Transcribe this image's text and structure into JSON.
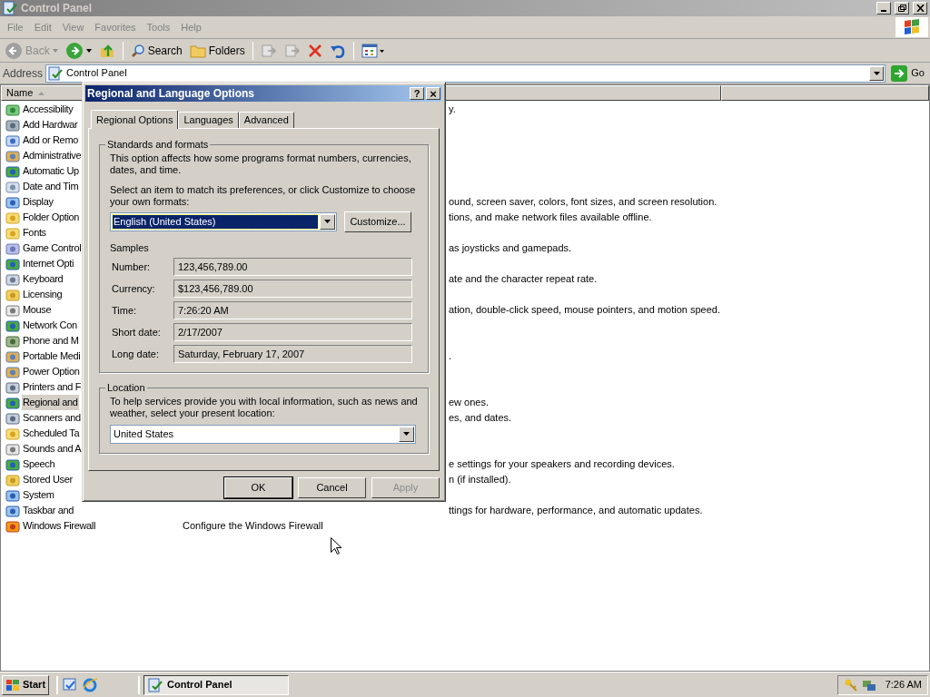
{
  "window": {
    "title": "Control Panel"
  },
  "menu": [
    "File",
    "Edit",
    "View",
    "Favorites",
    "Tools",
    "Help"
  ],
  "toolbar": [
    {
      "kind": "back",
      "label": "Back",
      "disabled": true
    },
    {
      "kind": "forward",
      "disabled": false
    },
    {
      "kind": "up",
      "disabled": false
    },
    {
      "kind": "sep"
    },
    {
      "kind": "search",
      "label": "Search",
      "disabled": false
    },
    {
      "kind": "folders",
      "label": "Folders",
      "disabled": false
    },
    {
      "kind": "sep"
    },
    {
      "kind": "moveto",
      "disabled": true
    },
    {
      "kind": "copyto",
      "disabled": true
    },
    {
      "kind": "delete",
      "disabled": false
    },
    {
      "kind": "undo",
      "disabled": false
    },
    {
      "kind": "sep"
    },
    {
      "kind": "views",
      "disabled": false
    }
  ],
  "address": {
    "label": "Address",
    "value": "Control Panel",
    "go": "Go"
  },
  "list": {
    "columns": [
      "Name"
    ],
    "rows": [
      {
        "name": "Accessibility",
        "comment": "y.",
        "selected": false
      },
      {
        "name": "Add Hardwar",
        "selected": false
      },
      {
        "name": "Add or Remo",
        "selected": false
      },
      {
        "name": "Administrative",
        "selected": false
      },
      {
        "name": "Automatic Up",
        "selected": false
      },
      {
        "name": "Date and Tim",
        "selected": false
      },
      {
        "name": "Display",
        "comment": "ound, screen saver, colors, font sizes, and screen resolution.",
        "selected": false
      },
      {
        "name": "Folder Option",
        "comment": "tions, and make network files available offline.",
        "selected": false
      },
      {
        "name": "Fonts",
        "selected": false
      },
      {
        "name": "Game Control",
        "comment": "as joysticks and gamepads.",
        "selected": false
      },
      {
        "name": "Internet Opti",
        "selected": false
      },
      {
        "name": "Keyboard",
        "comment": "ate and the character repeat rate.",
        "selected": false
      },
      {
        "name": "Licensing",
        "selected": false
      },
      {
        "name": "Mouse",
        "comment": "ation, double-click speed, mouse pointers, and motion speed.",
        "selected": false
      },
      {
        "name": "Network Con",
        "selected": false
      },
      {
        "name": "Phone and M",
        "selected": false
      },
      {
        "name": "Portable Medi",
        "comment": ".",
        "selected": false
      },
      {
        "name": "Power Option",
        "selected": false
      },
      {
        "name": "Printers and F",
        "selected": false
      },
      {
        "name": "Regional and",
        "comment": "ew ones.",
        "selected": true
      },
      {
        "name": "Scanners and",
        "comment": "es, and dates.",
        "selected": false
      },
      {
        "name": "Scheduled Ta",
        "selected": false
      },
      {
        "name": "Sounds and A",
        "selected": false
      },
      {
        "name": "Speech",
        "comment": "e settings for your speakers and recording devices.",
        "selected": false
      },
      {
        "name": "Stored User",
        "comment": "n (if installed).",
        "selected": false
      },
      {
        "name": "System",
        "selected": false
      },
      {
        "name": "Taskbar and",
        "comment": "ttings for hardware, performance, and automatic updates.",
        "selected": false
      },
      {
        "name": "Windows Firewall",
        "comment": "Configure the Windows Firewall",
        "selected": false
      }
    ]
  },
  "dialog": {
    "title": "Regional and Language Options",
    "help": "?",
    "close": "×",
    "tabs": [
      {
        "label": "Regional Options",
        "selected": true
      },
      {
        "label": "Languages",
        "selected": false
      },
      {
        "label": "Advanced",
        "selected": false
      }
    ],
    "standards": {
      "legend": "Standards and formats",
      "intro": "This option affects how some programs format numbers, currencies, dates, and time.",
      "prompt": "Select an item to match its preferences, or click Customize to choose your own formats:",
      "format": "English (United States)",
      "customize": "Customize...",
      "samples_label": "Samples",
      "samples": [
        {
          "label": "Number:",
          "value": "123,456,789.00"
        },
        {
          "label": "Currency:",
          "value": "$123,456,789.00"
        },
        {
          "label": "Time:",
          "value": "7:26:20 AM"
        },
        {
          "label": "Short date:",
          "value": "2/17/2007"
        },
        {
          "label": "Long date:",
          "value": "Saturday, February 17, 2007"
        }
      ]
    },
    "location": {
      "legend": "Location",
      "text": "To help services provide you with local information, such as news and weather, select your present location:",
      "value": "United States"
    },
    "buttons": [
      {
        "label": "OK",
        "disabled": false
      },
      {
        "label": "Cancel",
        "disabled": false
      },
      {
        "label": "Apply",
        "disabled": true
      }
    ]
  },
  "taskbar": {
    "start": "Start",
    "tasks": [
      {
        "label": "Control Panel",
        "selected": true
      }
    ],
    "clock": "7:26 AM"
  }
}
